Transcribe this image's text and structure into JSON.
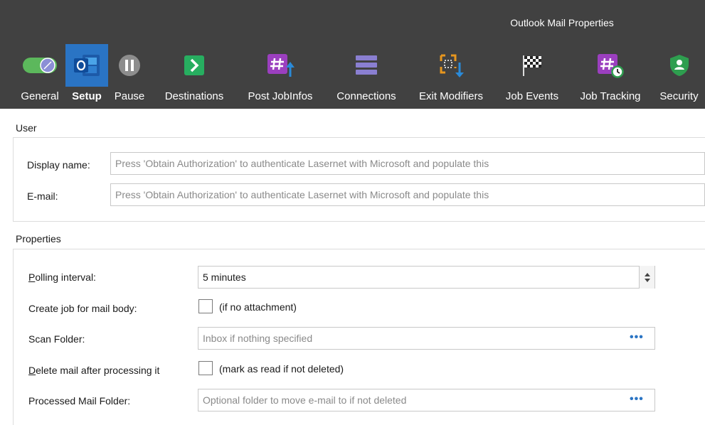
{
  "window": {
    "title": "Outlook Mail Properties"
  },
  "toolbar": {
    "items": [
      {
        "label": "General",
        "icon": "toggle-switch-icon",
        "active": false
      },
      {
        "label": "Setup",
        "icon": "outlook-icon",
        "active": true
      },
      {
        "label": "Pause",
        "icon": "pause-icon",
        "active": false
      },
      {
        "label": "Destinations",
        "icon": "arrow-right-icon",
        "active": false
      },
      {
        "label": "Post JobInfos",
        "icon": "hash-arrow-up-icon",
        "active": false
      },
      {
        "label": "Connections",
        "icon": "stacked-bars-icon",
        "active": false
      },
      {
        "label": "Exit Modifiers",
        "icon": "bracket-arrow-icon",
        "active": false
      },
      {
        "label": "Job Events",
        "icon": "checkered-flag-icon",
        "active": false
      },
      {
        "label": "Job Tracking",
        "icon": "hash-clock-icon",
        "active": false
      },
      {
        "label": "Security",
        "icon": "shield-user-icon",
        "active": false
      }
    ]
  },
  "user": {
    "section_label": "User",
    "display_name_label": "Display name:",
    "display_name_placeholder": "Press 'Obtain Authorization' to authenticate Lasernet with Microsoft and populate this",
    "email_label": "E-mail:",
    "email_placeholder": "Press 'Obtain Authorization' to authenticate Lasernet with Microsoft and populate this"
  },
  "properties": {
    "section_label": "Properties",
    "polling_interval_label_accel": "P",
    "polling_interval_label_rest": "olling interval:",
    "polling_interval_value": "5 minutes",
    "create_job_label": "Create job for mail body:",
    "create_job_note": "(if no attachment)",
    "scan_folder_label": "Scan Folder:",
    "scan_folder_placeholder": "Inbox if nothing specified",
    "delete_mail_label_accel": "D",
    "delete_mail_label_rest": "elete mail after processing it",
    "delete_mail_note": "(mark as read if not deleted)",
    "processed_folder_label": "Processed Mail Folder:",
    "processed_folder_placeholder": "Optional folder to move e-mail to if not deleted",
    "browse_label": "•••"
  },
  "colors": {
    "ribbon_bg": "#414141",
    "active_tool_bg": "#2a74c4",
    "toggle_green": "#5cb85c",
    "destinations_green": "#27ae60",
    "purple": "#9b3fbf",
    "security_green": "#2e9e4f",
    "orange": "#e7961e",
    "accent_blue": "#2a74c4"
  }
}
